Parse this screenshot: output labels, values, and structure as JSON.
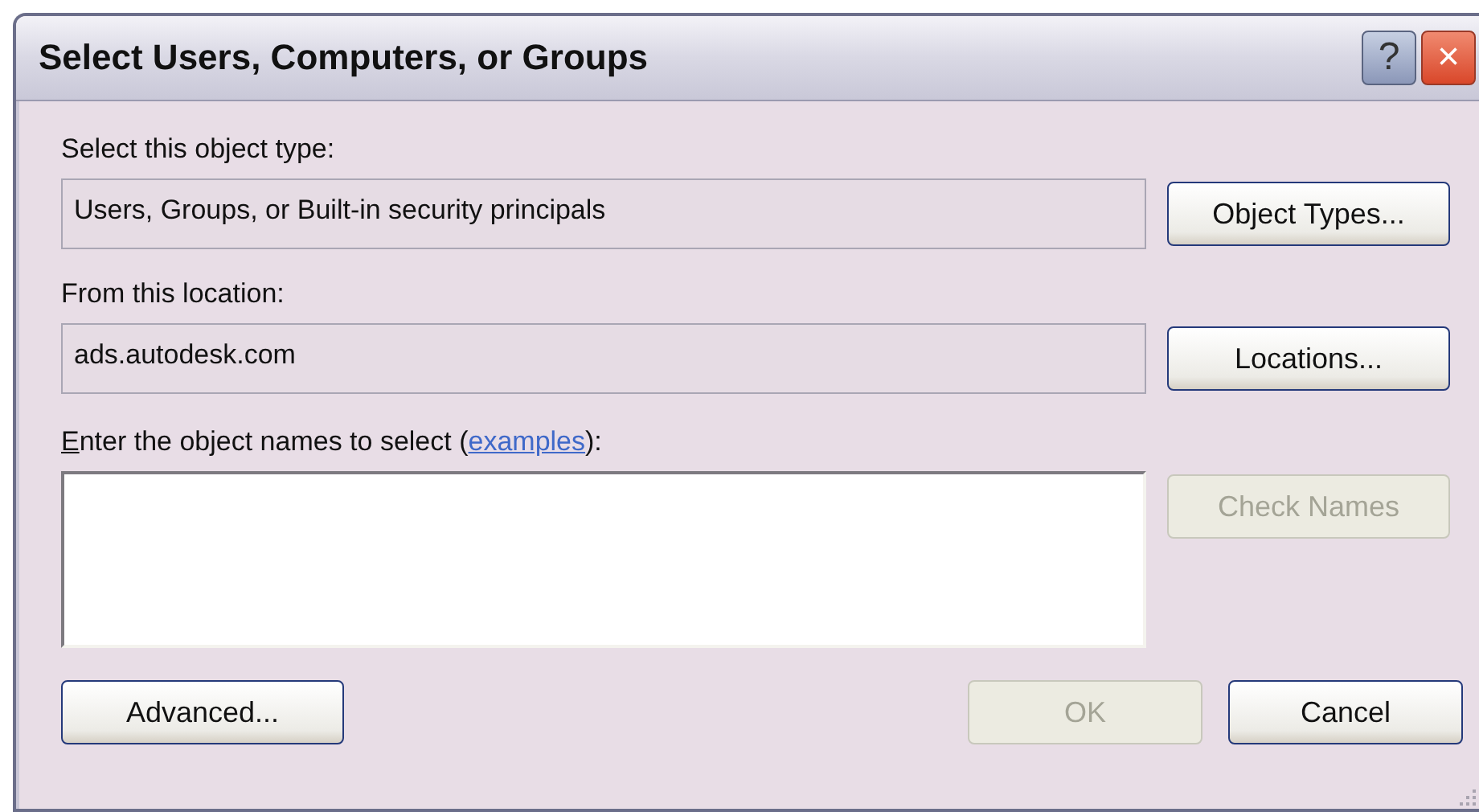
{
  "window": {
    "title": "Select Users, Computers, or Groups",
    "controls": [
      "?",
      "×"
    ]
  },
  "object_type": {
    "label": "Select this object type:",
    "value": "Users, Groups, or Built-in security principals",
    "button": {
      "label": "Object Types...",
      "disabled": false
    }
  },
  "location": {
    "label": "From this location:",
    "value": "ads.autodesk.com",
    "button": {
      "label": "Locations...",
      "disabled": false
    }
  },
  "names": {
    "label": {
      "mnemonic": "E",
      "text": "nter the object names to select (",
      "link": "examples",
      "suffix": "):"
    },
    "button": {
      "label": "Check Names",
      "disabled": true
    }
  },
  "buttons": [
    {
      "label": "Advanced...",
      "disabled": false
    },
    {
      "label": "OK",
      "disabled": true
    },
    {
      "label": "Cancel",
      "disabled": false
    }
  ]
}
